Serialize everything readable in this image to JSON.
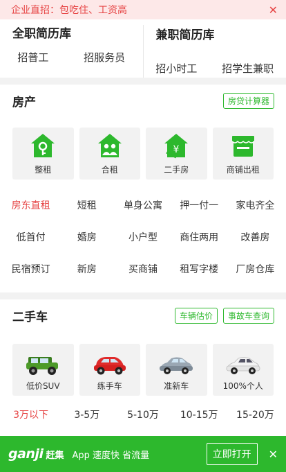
{
  "top_banner": {
    "text": "企业直招：包吃住、工资高",
    "close": "✕"
  },
  "resume": {
    "fulltime": {
      "title": "全职简历库",
      "links": [
        "招普工",
        "招服务员"
      ]
    },
    "parttime": {
      "title": "兼职简历库",
      "links": [
        "招小时工",
        "招学生兼职"
      ]
    }
  },
  "house": {
    "title": "房产",
    "calc_button": "房贷计算器",
    "tiles": [
      {
        "label": "整租",
        "icon": "house-key-icon"
      },
      {
        "label": "合租",
        "icon": "house-people-icon"
      },
      {
        "label": "二手房",
        "icon": "house-yen-icon"
      },
      {
        "label": "商铺出租",
        "icon": "shop-icon"
      }
    ],
    "links": [
      "房东直租",
      "短租",
      "单身公寓",
      "押一付一",
      "家电齐全",
      "低首付",
      "婚房",
      "小户型",
      "商住两用",
      "改善房",
      "民宿预订",
      "新房",
      "买商铺",
      "租写字楼",
      "厂房仓库"
    ]
  },
  "car": {
    "title": "二手车",
    "valuation_button": "车辆估价",
    "accident_button": "事故车查询",
    "tiles": [
      {
        "label": "低价SUV",
        "icon": "suv-icon"
      },
      {
        "label": "练手车",
        "icon": "hatchback-icon"
      },
      {
        "label": "准新车",
        "icon": "sedan-icon"
      },
      {
        "label": "100%个人",
        "icon": "white-sedan-icon"
      }
    ],
    "prices": [
      "3万以下",
      "3-5万",
      "5-10万",
      "10-15万",
      "15-20万"
    ]
  },
  "bottom_bar": {
    "logo": "ganji",
    "logo_cn": "赶集",
    "tagline": "App 速度快 省流量",
    "open_button": "立即打开",
    "close": "✕"
  },
  "colors": {
    "green": "#2db82d",
    "red": "#e64545",
    "banner_bg": "#fde8e8"
  }
}
